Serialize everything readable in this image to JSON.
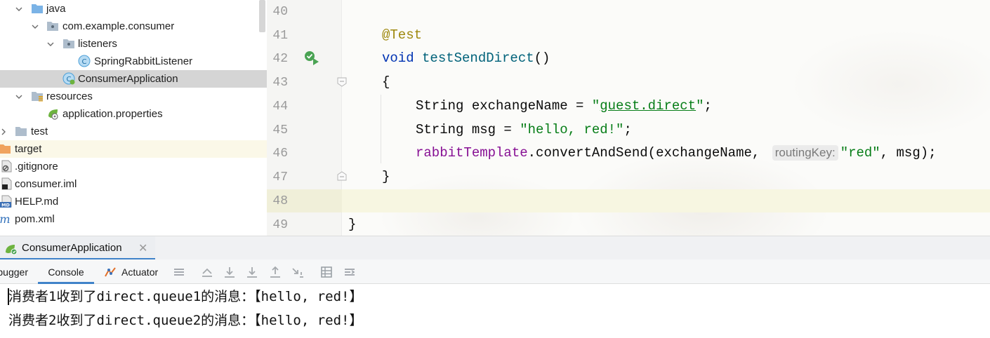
{
  "project_tree": {
    "items": [
      {
        "label": "java",
        "icon": "folder-icon",
        "expanded": true
      },
      {
        "label": "com.example.consumer",
        "icon": "package-icon",
        "expanded": true
      },
      {
        "label": "listeners",
        "icon": "package-icon",
        "expanded": true
      },
      {
        "label": "SpringRabbitListener",
        "icon": "java-class-icon"
      },
      {
        "label": "ConsumerApplication",
        "icon": "spring-boot-class-icon",
        "selected": true
      },
      {
        "label": "resources",
        "icon": "resources-folder-icon",
        "expanded": true
      },
      {
        "label": "application.properties",
        "icon": "spring-properties-icon"
      },
      {
        "label": "test",
        "icon": "folder-icon",
        "expanded": false
      },
      {
        "label": "target",
        "icon": "excluded-folder-icon",
        "excluded": true
      },
      {
        "label": ".gitignore",
        "icon": "gitignore-icon"
      },
      {
        "label": "consumer.iml",
        "icon": "iml-icon"
      },
      {
        "label": "HELP.md",
        "icon": "markdown-icon"
      },
      {
        "label": "pom.xml",
        "icon": "maven-icon"
      }
    ]
  },
  "editor": {
    "line_numbers": [
      "40",
      "41",
      "42",
      "43",
      "44",
      "45",
      "46",
      "47",
      "48",
      "49"
    ],
    "code": {
      "annotation": "@Test",
      "void_kw": "void",
      "method_name": "testSendDirect",
      "method_parens": "()",
      "open_brace": "{",
      "l44_type": "String exchangeName = ",
      "l44_str_q1": "\"",
      "l44_str_val": "guest.direct",
      "l44_str_q2": "\"",
      "l44_end": ";",
      "l45_type": "String msg = ",
      "l45_str": "\"hello, red!\"",
      "l45_end": ";",
      "l46_field": "rabbitTemplate",
      "l46_call": ".convertAndSend(exchangeName, ",
      "l46_hint": "routingKey:",
      "l46_str": "\"red\"",
      "l46_end": ", msg);",
      "close_brace_method": "}",
      "close_brace_class": "}"
    }
  },
  "run_window": {
    "tab_label": "ConsumerApplication",
    "close_glyph": "✕",
    "tool_tabs": {
      "debugger": "Debugger",
      "console": "Console",
      "actuator": "Actuator"
    },
    "console_lines": [
      "消费者1收到了direct.queue1的消息：【hello, red!】",
      "消费者2收到了direct.queue2的消息：【hello, red!】"
    ]
  },
  "colors": {
    "keyword": "#0033b3",
    "string": "#067d17",
    "annotation": "#9e880d",
    "field": "#871094",
    "method": "#00627a",
    "accent": "#4083c9"
  }
}
